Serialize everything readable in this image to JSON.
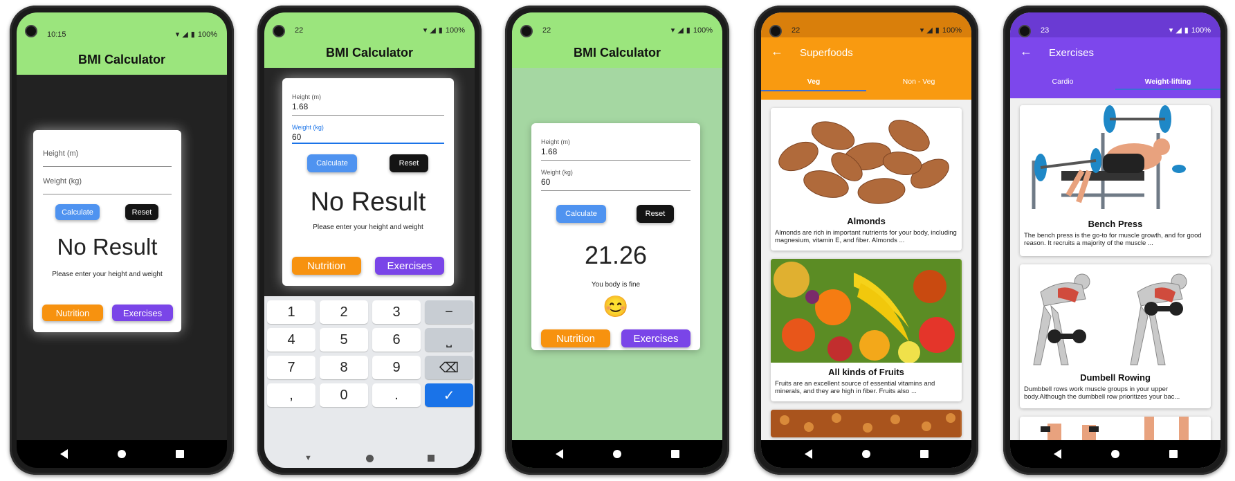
{
  "colors": {
    "appbar_green": "#9be57d",
    "orange": "#f7920f",
    "purple": "#7a45e8",
    "blue": "#4f93f0",
    "result_bg": "#a5d7a2"
  },
  "status": {
    "p1_time": "10:15",
    "p2_time": "22",
    "p3_time": "22",
    "p4_time": "22",
    "p5_time": "23",
    "battery": "100%"
  },
  "bmi": {
    "title": "BMI Calculator",
    "height_label": "Height (m)",
    "weight_label": "Weight (kg)",
    "calculate": "Calculate",
    "reset": "Reset",
    "no_result": "No Result",
    "prompt": "Please enter your height and weight",
    "nutrition": "Nutrition",
    "exercises": "Exercises"
  },
  "screen2": {
    "height_value": "1.68",
    "weight_value": "60",
    "keys": [
      "1",
      "2",
      "3",
      "−",
      "4",
      "5",
      "6",
      "⎵",
      "7",
      "8",
      "9",
      "⌫",
      ",",
      "0",
      ".",
      "✓"
    ]
  },
  "screen3": {
    "height_value": "1.68",
    "weight_value": "60",
    "result": "21.26",
    "message": "You body is fine",
    "emoji": "😊"
  },
  "superfoods": {
    "title": "Superfoods",
    "tabs": [
      "Veg",
      "Non - Veg"
    ],
    "items": [
      {
        "title": "Almonds",
        "desc": "Almonds are rich in important nutrients for your body, including magnesium, vitamin E, and fiber. Almonds ..."
      },
      {
        "title": "All kinds of Fruits",
        "desc": "Fruits are an excellent source of essential vitamins and minerals, and they are high in fiber. Fruits also ..."
      }
    ]
  },
  "exercises": {
    "title": "Exercises",
    "tabs": [
      "Cardio",
      "Weight-lifting"
    ],
    "items": [
      {
        "title": "Bench Press",
        "desc": "The bench press is the go-to for muscle growth, and for good reason. It recruits a majority of the muscle ..."
      },
      {
        "title": "Dumbell Rowing",
        "desc": "Dumbbell rows work muscle groups in your upper body.Although the dumbbell row prioritizes your bac..."
      }
    ]
  }
}
